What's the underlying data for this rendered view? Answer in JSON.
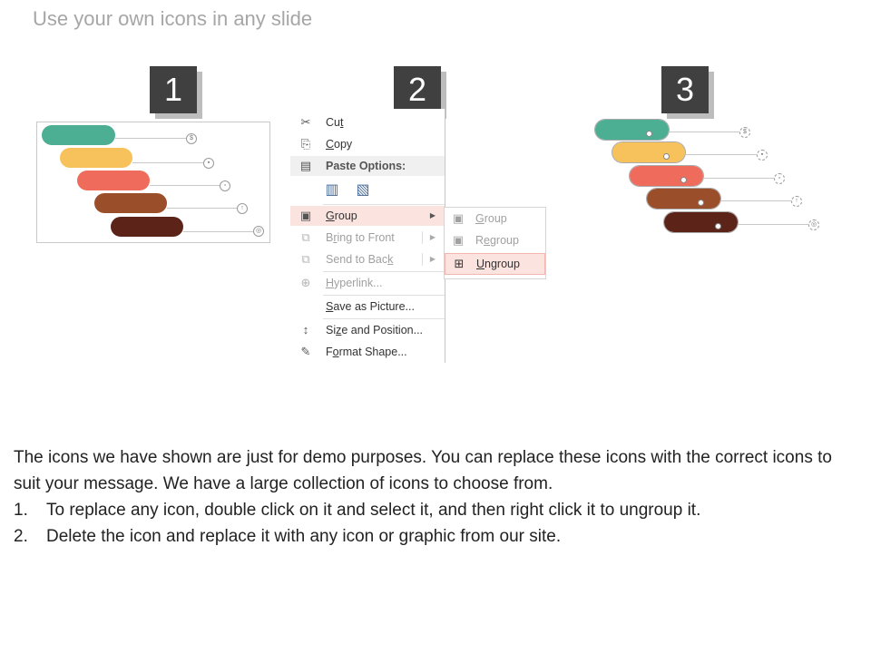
{
  "title": "Use your own icons in any slide",
  "steps": [
    "1",
    "2",
    "3"
  ],
  "bar_colors": [
    "#4caf93",
    "#f7c25b",
    "#ef6b5b",
    "#9b4e2a",
    "#5c2419"
  ],
  "menu": {
    "items": [
      {
        "label": "Cut",
        "icon": "scissors-icon",
        "glyph": "✂",
        "key": "t"
      },
      {
        "label": "Copy",
        "icon": "copy-icon",
        "glyph": "⎘",
        "key": "C"
      },
      {
        "label": "Paste Options:",
        "icon": "paste-icon",
        "glyph": "📋"
      },
      {
        "label": "Group",
        "icon": "group-icon",
        "glyph": "▣",
        "key": "G"
      },
      {
        "label": "Bring to Front",
        "icon": "bring-front-icon",
        "glyph": "⧉",
        "key": "r"
      },
      {
        "label": "Send to Back",
        "icon": "send-back-icon",
        "glyph": "⧉",
        "key": "k"
      },
      {
        "label": "Hyperlink...",
        "icon": "hyperlink-icon",
        "glyph": "🌐",
        "key": "H"
      },
      {
        "label": "Save as Picture...",
        "key": "S"
      },
      {
        "label": "Size and Position...",
        "icon": "size-position-icon",
        "glyph": "↕",
        "key": "z"
      },
      {
        "label": "Format Shape...",
        "icon": "format-shape-icon",
        "glyph": "🖌",
        "key": "o"
      }
    ]
  },
  "submenu": {
    "items": [
      {
        "label": "Group",
        "icon": "group-icon"
      },
      {
        "label": "Regroup",
        "icon": "regroup-icon"
      },
      {
        "label": "Ungroup",
        "icon": "ungroup-icon"
      }
    ]
  },
  "description": {
    "intro": "The icons we have shown are just for demo purposes. You can replace these icons with the correct icons to suit your message. We have a large collection of icons to choose from.",
    "steps": [
      {
        "num": "1.",
        "text": "To replace any icon, double click on it and select it, and then right click it to ungroup it."
      },
      {
        "num": "2.",
        "text": "Delete the icon and replace it with any icon or graphic from our site."
      }
    ]
  }
}
